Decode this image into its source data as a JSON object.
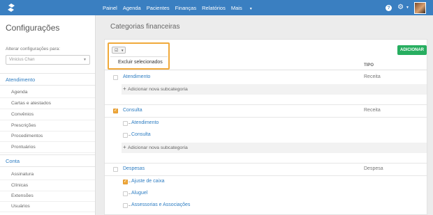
{
  "topbar": {
    "nav": [
      "Painel",
      "Agenda",
      "Pacientes",
      "Finanças",
      "Relatórios",
      "Mais"
    ],
    "help_label": "?"
  },
  "sidebar": {
    "title": "Configurações",
    "user_label": "Alterar configurações para:",
    "user_value": "Vinicius Chan",
    "sections": [
      {
        "label": "Atendimento",
        "items": [
          "Agenda",
          "Cartas e atestados",
          "Convênios",
          "Prescrições",
          "Procedimentos",
          "Prontuários"
        ]
      },
      {
        "label": "Conta",
        "items": [
          "Assinatura",
          "Clínicas",
          "Extensões",
          "Usuários"
        ]
      }
    ]
  },
  "main": {
    "title": "Categorias financeiras",
    "bulk_menu_item": "Excluir selecionados",
    "add_button": "ADICIONAR",
    "col_type": "TIPO",
    "add_subcategory": "Adicionar nova subcategoria",
    "categories": [
      {
        "name": "Atendimento",
        "type": "Receita",
        "checked": false,
        "subs": []
      },
      {
        "name": "Consulta",
        "type": "Receita",
        "checked": true,
        "subs": [
          {
            "name": "Atendimento",
            "checked": false
          },
          {
            "name": "Consulta",
            "checked": false
          }
        ]
      },
      {
        "name": "Despesas",
        "type": "Despesa",
        "checked": false,
        "subs": [
          {
            "name": "Ajuste de caixa",
            "checked": true
          },
          {
            "name": "Aluguel",
            "checked": false
          },
          {
            "name": "Assessorias e Associações",
            "checked": false
          }
        ]
      }
    ]
  },
  "colors": {
    "topbar": "#3a7fc1",
    "link": "#2e7dc2",
    "accent": "#f0a93a",
    "add": "#27ae60"
  }
}
